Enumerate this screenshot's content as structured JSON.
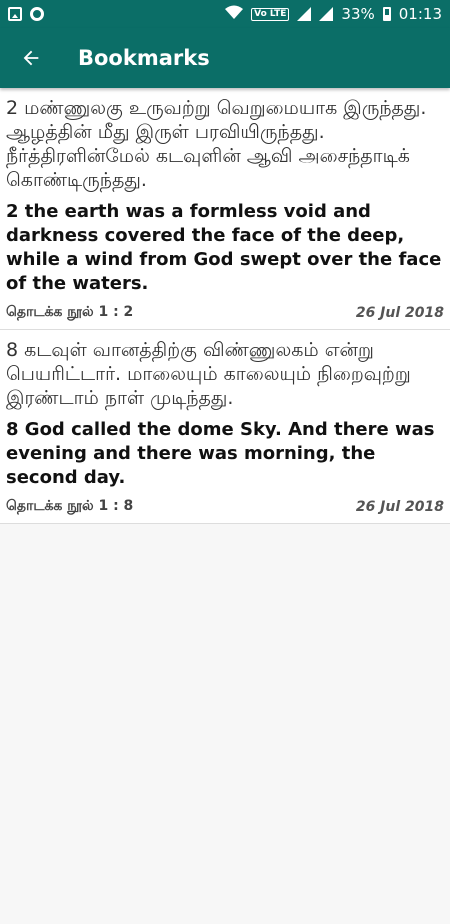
{
  "status_bar": {
    "battery": "33%",
    "time": "01:13",
    "volte": "Vo LTE"
  },
  "app_bar": {
    "title": "Bookmarks"
  },
  "bookmarks": [
    {
      "tamil": "2 மண்ணுலகு உருவற்று வெறுமையாக இருந்தது. ஆழத்தின் மீது இருள் பரவியிருந்தது. நீர்த்திரளின்மேல் கடவுளின் ஆவி அசைந்தாடிக் கொண்டிருந்தது.",
      "english": "2 the earth was a formless void and darkness covered the face of the deep, while a wind from God swept over the face of the waters.",
      "reference": "தொடக்க நூல் 1 : 2",
      "date": "26 Jul 2018"
    },
    {
      "tamil": "8 கடவுள் வானத்திற்கு விண்ணுலகம் என்று பெயரிட்டார். மாலையும் காலையும் நிறைவுற்று இரண்டாம் நாள் முடிந்தது.",
      "english": "8 God called the dome Sky. And there was evening and there was morning, the second day.",
      "reference": "தொடக்க நூல் 1 : 8",
      "date": "26 Jul 2018"
    }
  ]
}
